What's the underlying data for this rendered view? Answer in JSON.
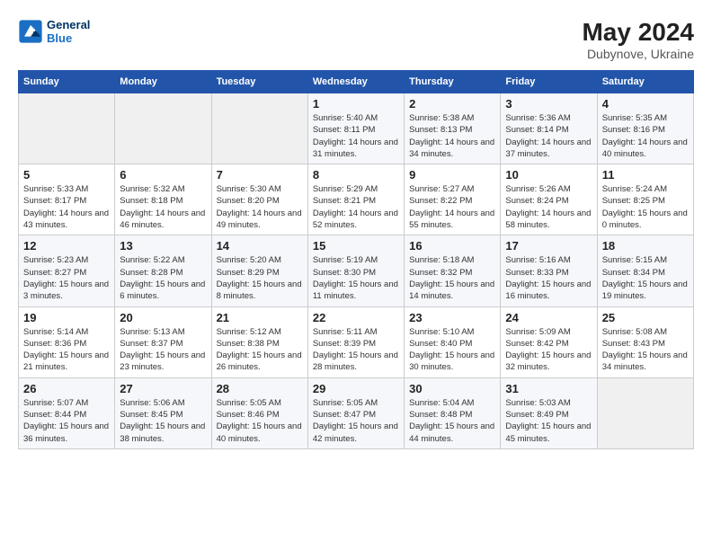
{
  "header": {
    "logo_line1": "General",
    "logo_line2": "Blue",
    "month_year": "May 2024",
    "location": "Dubynove, Ukraine"
  },
  "days_of_week": [
    "Sunday",
    "Monday",
    "Tuesday",
    "Wednesday",
    "Thursday",
    "Friday",
    "Saturday"
  ],
  "weeks": [
    [
      {
        "num": "",
        "info": ""
      },
      {
        "num": "",
        "info": ""
      },
      {
        "num": "",
        "info": ""
      },
      {
        "num": "1",
        "info": "Sunrise: 5:40 AM\nSunset: 8:11 PM\nDaylight: 14 hours and 31 minutes."
      },
      {
        "num": "2",
        "info": "Sunrise: 5:38 AM\nSunset: 8:13 PM\nDaylight: 14 hours and 34 minutes."
      },
      {
        "num": "3",
        "info": "Sunrise: 5:36 AM\nSunset: 8:14 PM\nDaylight: 14 hours and 37 minutes."
      },
      {
        "num": "4",
        "info": "Sunrise: 5:35 AM\nSunset: 8:16 PM\nDaylight: 14 hours and 40 minutes."
      }
    ],
    [
      {
        "num": "5",
        "info": "Sunrise: 5:33 AM\nSunset: 8:17 PM\nDaylight: 14 hours and 43 minutes."
      },
      {
        "num": "6",
        "info": "Sunrise: 5:32 AM\nSunset: 8:18 PM\nDaylight: 14 hours and 46 minutes."
      },
      {
        "num": "7",
        "info": "Sunrise: 5:30 AM\nSunset: 8:20 PM\nDaylight: 14 hours and 49 minutes."
      },
      {
        "num": "8",
        "info": "Sunrise: 5:29 AM\nSunset: 8:21 PM\nDaylight: 14 hours and 52 minutes."
      },
      {
        "num": "9",
        "info": "Sunrise: 5:27 AM\nSunset: 8:22 PM\nDaylight: 14 hours and 55 minutes."
      },
      {
        "num": "10",
        "info": "Sunrise: 5:26 AM\nSunset: 8:24 PM\nDaylight: 14 hours and 58 minutes."
      },
      {
        "num": "11",
        "info": "Sunrise: 5:24 AM\nSunset: 8:25 PM\nDaylight: 15 hours and 0 minutes."
      }
    ],
    [
      {
        "num": "12",
        "info": "Sunrise: 5:23 AM\nSunset: 8:27 PM\nDaylight: 15 hours and 3 minutes."
      },
      {
        "num": "13",
        "info": "Sunrise: 5:22 AM\nSunset: 8:28 PM\nDaylight: 15 hours and 6 minutes."
      },
      {
        "num": "14",
        "info": "Sunrise: 5:20 AM\nSunset: 8:29 PM\nDaylight: 15 hours and 8 minutes."
      },
      {
        "num": "15",
        "info": "Sunrise: 5:19 AM\nSunset: 8:30 PM\nDaylight: 15 hours and 11 minutes."
      },
      {
        "num": "16",
        "info": "Sunrise: 5:18 AM\nSunset: 8:32 PM\nDaylight: 15 hours and 14 minutes."
      },
      {
        "num": "17",
        "info": "Sunrise: 5:16 AM\nSunset: 8:33 PM\nDaylight: 15 hours and 16 minutes."
      },
      {
        "num": "18",
        "info": "Sunrise: 5:15 AM\nSunset: 8:34 PM\nDaylight: 15 hours and 19 minutes."
      }
    ],
    [
      {
        "num": "19",
        "info": "Sunrise: 5:14 AM\nSunset: 8:36 PM\nDaylight: 15 hours and 21 minutes."
      },
      {
        "num": "20",
        "info": "Sunrise: 5:13 AM\nSunset: 8:37 PM\nDaylight: 15 hours and 23 minutes."
      },
      {
        "num": "21",
        "info": "Sunrise: 5:12 AM\nSunset: 8:38 PM\nDaylight: 15 hours and 26 minutes."
      },
      {
        "num": "22",
        "info": "Sunrise: 5:11 AM\nSunset: 8:39 PM\nDaylight: 15 hours and 28 minutes."
      },
      {
        "num": "23",
        "info": "Sunrise: 5:10 AM\nSunset: 8:40 PM\nDaylight: 15 hours and 30 minutes."
      },
      {
        "num": "24",
        "info": "Sunrise: 5:09 AM\nSunset: 8:42 PM\nDaylight: 15 hours and 32 minutes."
      },
      {
        "num": "25",
        "info": "Sunrise: 5:08 AM\nSunset: 8:43 PM\nDaylight: 15 hours and 34 minutes."
      }
    ],
    [
      {
        "num": "26",
        "info": "Sunrise: 5:07 AM\nSunset: 8:44 PM\nDaylight: 15 hours and 36 minutes."
      },
      {
        "num": "27",
        "info": "Sunrise: 5:06 AM\nSunset: 8:45 PM\nDaylight: 15 hours and 38 minutes."
      },
      {
        "num": "28",
        "info": "Sunrise: 5:05 AM\nSunset: 8:46 PM\nDaylight: 15 hours and 40 minutes."
      },
      {
        "num": "29",
        "info": "Sunrise: 5:05 AM\nSunset: 8:47 PM\nDaylight: 15 hours and 42 minutes."
      },
      {
        "num": "30",
        "info": "Sunrise: 5:04 AM\nSunset: 8:48 PM\nDaylight: 15 hours and 44 minutes."
      },
      {
        "num": "31",
        "info": "Sunrise: 5:03 AM\nSunset: 8:49 PM\nDaylight: 15 hours and 45 minutes."
      },
      {
        "num": "",
        "info": ""
      }
    ]
  ]
}
